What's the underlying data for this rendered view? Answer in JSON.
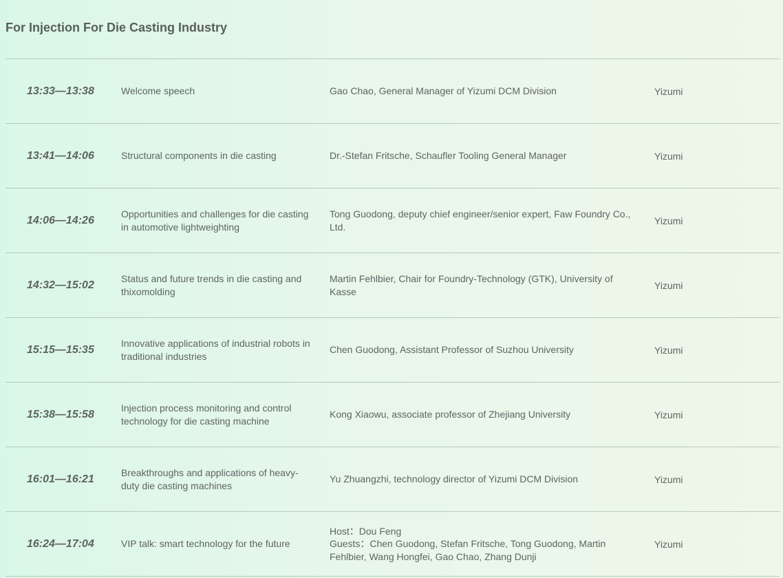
{
  "page": {
    "title": "For Injection For Die Casting Industry"
  },
  "schedule": [
    {
      "time": "13:33—13:38",
      "topic": "Welcome speech",
      "speaker": "Gao Chao, General Manager of Yizumi DCM Division",
      "org": "Yizumi"
    },
    {
      "time": "13:41—14:06",
      "topic": "Structural components in die casting",
      "speaker": "Dr.-Stefan Fritsche, Schaufler Tooling General Manager",
      "org": "Yizumi"
    },
    {
      "time": "14:06—14:26",
      "topic": "Opportunities and challenges for die casting in automotive lightweighting",
      "speaker": "Tong Guodong, deputy chief engineer/senior expert, Faw Foundry Co., Ltd.",
      "org": "Yizumi"
    },
    {
      "time": "14:32—15:02",
      "topic": "Status and future trends in die casting and thixomolding",
      "speaker": "Martin Fehlbier, Chair for Foundry-Technology (GTK), University of Kasse",
      "org": "Yizumi"
    },
    {
      "time": "15:15—15:35",
      "topic": "Innovative applications of industrial robots in traditional industries",
      "speaker": "Chen Guodong, Assistant Professor of Suzhou University",
      "org": "Yizumi"
    },
    {
      "time": "15:38—15:58",
      "topic": "Injection process monitoring and control technology for die casting machine",
      "speaker": "Kong Xiaowu, associate professor of Zhejiang University",
      "org": "Yizumi"
    },
    {
      "time": "16:01—16:21",
      "topic": "Breakthroughs and applications of heavy-duty die casting machines",
      "speaker": "Yu Zhuangzhi, technology director of Yizumi DCM Division",
      "org": "Yizumi"
    },
    {
      "time": "16:24—17:04",
      "topic": "VIP talk: smart technology for the future",
      "speaker_host": "Host：Dou Feng",
      "speaker_guests": "Guests：Chen Guodong, Stefan Fritsche, Tong Guodong, Martin Fehlbier, Wang Hongfei, Gao Chao, Zhang Dunji",
      "org": "Yizumi"
    }
  ]
}
